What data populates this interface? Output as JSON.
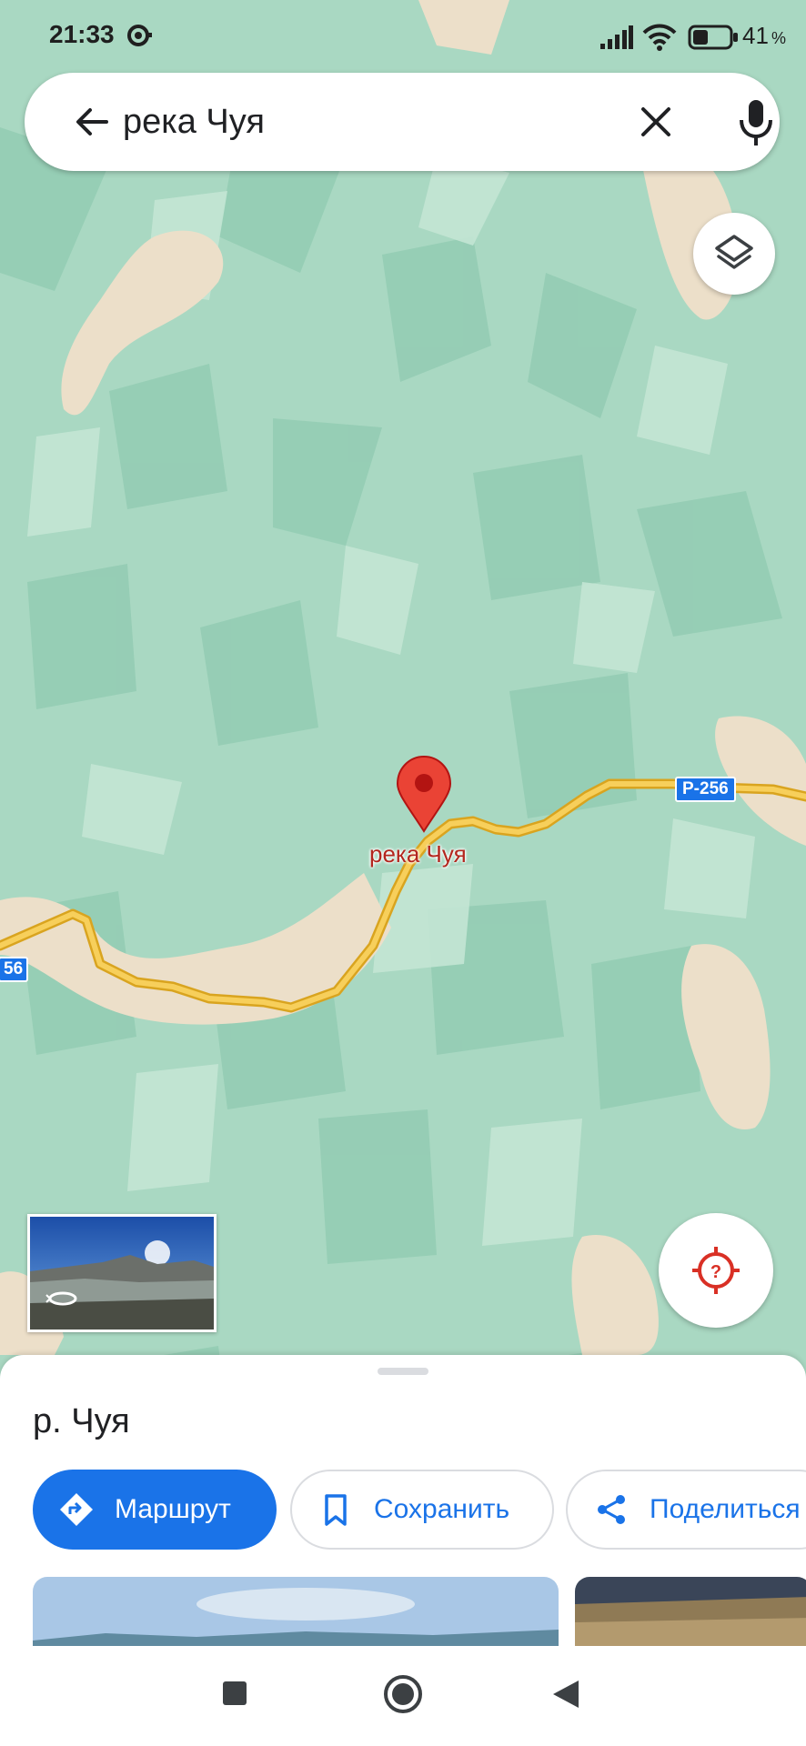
{
  "status_bar": {
    "time": "21:33",
    "battery_percent": "41",
    "battery_level": 0.41,
    "percent_sign": "%",
    "icons": [
      "notification-icon",
      "signal-icon",
      "wifi-icon",
      "battery-icon"
    ]
  },
  "search": {
    "query": "река Чуя",
    "icons": [
      "back-arrow-icon",
      "close-icon",
      "mic-icon"
    ]
  },
  "map": {
    "pin_label": "река Чуя",
    "road_label_right": "Р-256",
    "road_label_left": "56",
    "colors": {
      "terrain": "#a9d8c2",
      "terrain_dark": "#8fcab0",
      "terrain_light": "#bfe3d1",
      "valley": "#ecdfc9",
      "road": "#f2c037",
      "road_outline": "#d9a41f",
      "pin": "#ea4335",
      "pin_dark": "#b31412"
    },
    "controls": [
      "layers-icon",
      "locate-icon",
      "street-view-thumbnail"
    ]
  },
  "sheet": {
    "title": "р. Чуя",
    "buttons": {
      "directions": "Маршрут",
      "save": "Сохранить",
      "share": "Поделиться"
    },
    "colors": {
      "primary": "#1a73e8",
      "outline": "#dadce0"
    }
  },
  "navbar": {
    "icons": [
      "recents-icon",
      "home-icon",
      "back-icon"
    ]
  }
}
